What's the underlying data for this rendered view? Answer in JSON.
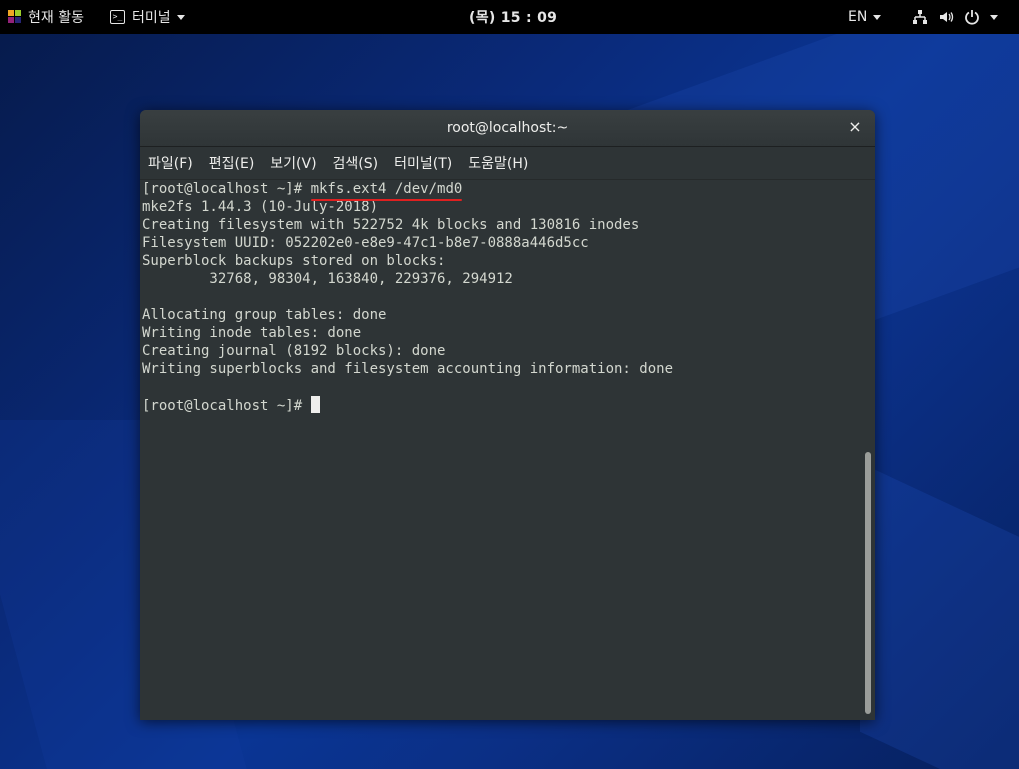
{
  "topbar": {
    "activities_label": "현재 활동",
    "app_menu_label": "터미널",
    "clock": "(목) 15 : 09",
    "language": "EN"
  },
  "window": {
    "title": "root@localhost:~",
    "close_symbol": "×"
  },
  "menu": {
    "items": [
      "파일(F)",
      "편집(E)",
      "보기(V)",
      "검색(S)",
      "터미널(T)",
      "도움말(H)"
    ]
  },
  "terminal": {
    "prompt": "[root@localhost ~]# ",
    "command": "mkfs.ext4 /dev/md0",
    "output": [
      "mke2fs 1.44.3 (10-July-2018)",
      "Creating filesystem with 522752 4k blocks and 130816 inodes",
      "Filesystem UUID: 052202e0-e8e9-47c1-b8e7-0888a446d5cc",
      "Superblock backups stored on blocks:",
      "        32768, 98304, 163840, 229376, 294912",
      "",
      "Allocating group tables: done",
      "Writing inode tables: done",
      "Creating journal (8192 blocks): done",
      "Writing superblocks and filesystem accounting information: done",
      ""
    ],
    "final_prompt": "[root@localhost ~]# "
  },
  "colors": {
    "terminal_bg": "#2e3436",
    "terminal_fg": "#d3d7cf",
    "underline": "#e02020",
    "topbar_bg": "#000000"
  }
}
